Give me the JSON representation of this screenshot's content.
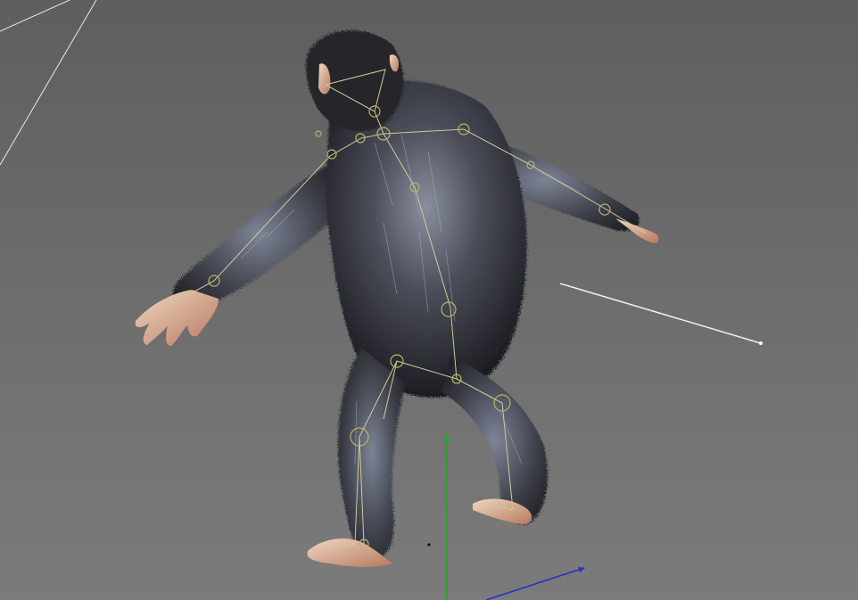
{
  "viewport": {
    "background_top": "#5e5e5e",
    "background_bottom": "#7b7b7b"
  },
  "scene": {
    "subject": "rigged-ape-character",
    "fur_color": "#2e3037",
    "fur_highlight": "#9aa3b6",
    "skin_color": "#d9a88c",
    "bone_color": "#cfc99a",
    "joint_color": "#b9b36a",
    "axis_y_color": "#2fa12f",
    "axis_x_color": "#2a2fc4",
    "guide_line_color": "#e8e8e8"
  }
}
